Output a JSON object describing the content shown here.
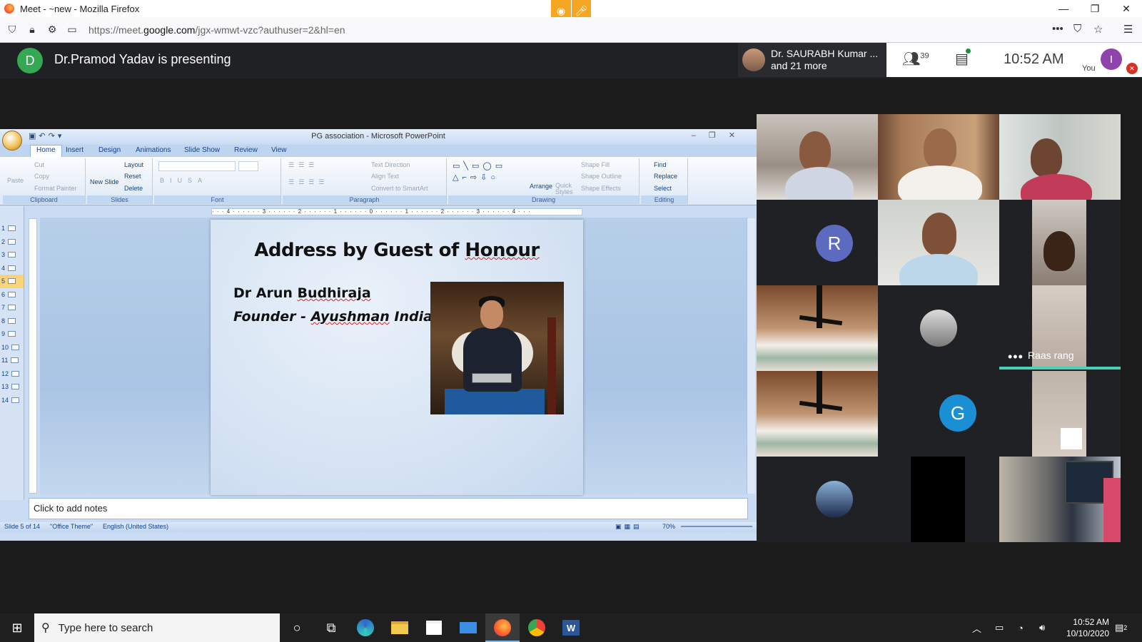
{
  "browser": {
    "window_title": "Meet - ~new - Mozilla Firefox",
    "url_prefix": "https://meet.",
    "url_domain": "google.com",
    "url_path": "/jgx-wmwt-vzc?authuser=2&hl=en"
  },
  "meet": {
    "presenter_initial": "D",
    "presenter_text": "Dr.Pramod Yadav is presenting",
    "speaker_name": "Dr. SAURABH Kumar ...",
    "speaker_more": "and 21 more",
    "participant_count": "39",
    "time": "10:52  AM",
    "you_label": "You",
    "user_initial": "I",
    "colors": {
      "presenter_avatar": "#34a853",
      "user_avatar": "#8e44ad",
      "accent": "#1a73e8"
    }
  },
  "ppt": {
    "caption": "PG association - Microsoft PowerPoint",
    "tabs": [
      "Home",
      "Insert",
      "Design",
      "Animations",
      "Slide Show",
      "Review",
      "View"
    ],
    "ribbon": {
      "clipboard": {
        "label": "Clipboard",
        "paste": "Paste",
        "cut": "Cut",
        "copy": "Copy",
        "format_painter": "Format Painter"
      },
      "slides": {
        "label": "Slides",
        "new_slide": "New Slide",
        "layout": "Layout",
        "reset": "Reset",
        "delete": "Delete"
      },
      "font": {
        "label": "Font"
      },
      "paragraph": {
        "label": "Paragraph",
        "text_direction": "Text Direction",
        "align_text": "Align Text",
        "convert": "Convert to SmartArt"
      },
      "drawing": {
        "label": "Drawing",
        "arrange": "Arrange",
        "quick_styles": "Quick Styles",
        "shape_fill": "Shape Fill",
        "shape_outline": "Shape Outline",
        "shape_effects": "Shape Effects"
      },
      "editing": {
        "label": "Editing",
        "find": "Find",
        "replace": "Replace",
        "select": "Select"
      }
    },
    "ruler_text": "· · · 4 · · · · · · 3 · · · · · · 2 · · · · · · 1 · · · · · · 0 · · · · · · 1 · · · · · · 2 · · · · · · 3 · · · · · · 4 · · ·",
    "slide_numbers": [
      "1",
      "2",
      "3",
      "4",
      "5",
      "6",
      "7",
      "8",
      "9",
      "10",
      "11",
      "12",
      "13",
      "14"
    ],
    "selected_slide": "5",
    "slide": {
      "title_a": "Address by Guest of ",
      "title_b": "Honour",
      "name_a": "Dr Arun ",
      "name_b": "Budhiraja",
      "role_a": "Founder - ",
      "role_b": "Ayushman",
      "role_c": " India"
    },
    "notes_placeholder": "Click to add notes",
    "status": {
      "slide": "Slide 5 of 14",
      "theme": "\"Office Theme\"",
      "language": "English (United States)",
      "zoom": "70%"
    }
  },
  "participants": {
    "r_initial": "R",
    "g_initial": "G",
    "raas_label": "Raas rang",
    "colors": {
      "r": "#5c6bc0",
      "g": "#1a8fd4"
    }
  },
  "taskbar": {
    "search_placeholder": "Type here to search",
    "time": "10:52 AM",
    "date": "10/10/2020",
    "notification_count": "2"
  }
}
